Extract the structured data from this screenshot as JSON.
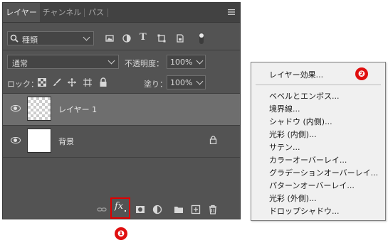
{
  "tabs": [
    {
      "label": "レイヤー",
      "active": true
    },
    {
      "label": "チャンネル",
      "active": false
    },
    {
      "label": "パス",
      "active": false
    }
  ],
  "panel_menu_icon": "hamburger-icon",
  "filter": {
    "kind_label": "種類",
    "icons": [
      "image-filter-icon",
      "adjustment-filter-icon",
      "type-filter-icon",
      "shape-filter-icon",
      "smartobject-filter-icon",
      "filter-toggle-icon"
    ]
  },
  "blend": {
    "mode": "通常",
    "opacity_label": "不透明度：",
    "opacity_value": "100%"
  },
  "lock": {
    "label": "ロック：",
    "fill_label": "塗り：",
    "fill_value": "100%"
  },
  "layers": [
    {
      "name": "レイヤー 1",
      "selected": true,
      "thumb": "transparent",
      "locked": false
    },
    {
      "name": "背景",
      "selected": false,
      "thumb": "white",
      "locked": true
    }
  ],
  "bottom_icons": [
    "link-layers-icon",
    "fx-icon",
    "add-mask-icon",
    "adjustment-layer-icon",
    "new-group-icon",
    "new-layer-icon",
    "delete-layer-icon"
  ],
  "fx_label": "fx",
  "menu": {
    "header": "レイヤー効果...",
    "items": [
      "ベベルとエンボス...",
      "境界線...",
      "シャドウ (内側)...",
      "光彩 (内側)...",
      "サテン...",
      "カラーオーバーレイ...",
      "グラデーションオーバーレイ...",
      "パターンオーバーレイ...",
      "光彩 (外側)...",
      "ドロップシャドウ..."
    ]
  },
  "badges": {
    "one": "❶",
    "two": "❷"
  },
  "colors": {
    "panel_bg": "#535353",
    "selected_layer": "#6e6e6e",
    "highlight_red": "#e00000"
  }
}
